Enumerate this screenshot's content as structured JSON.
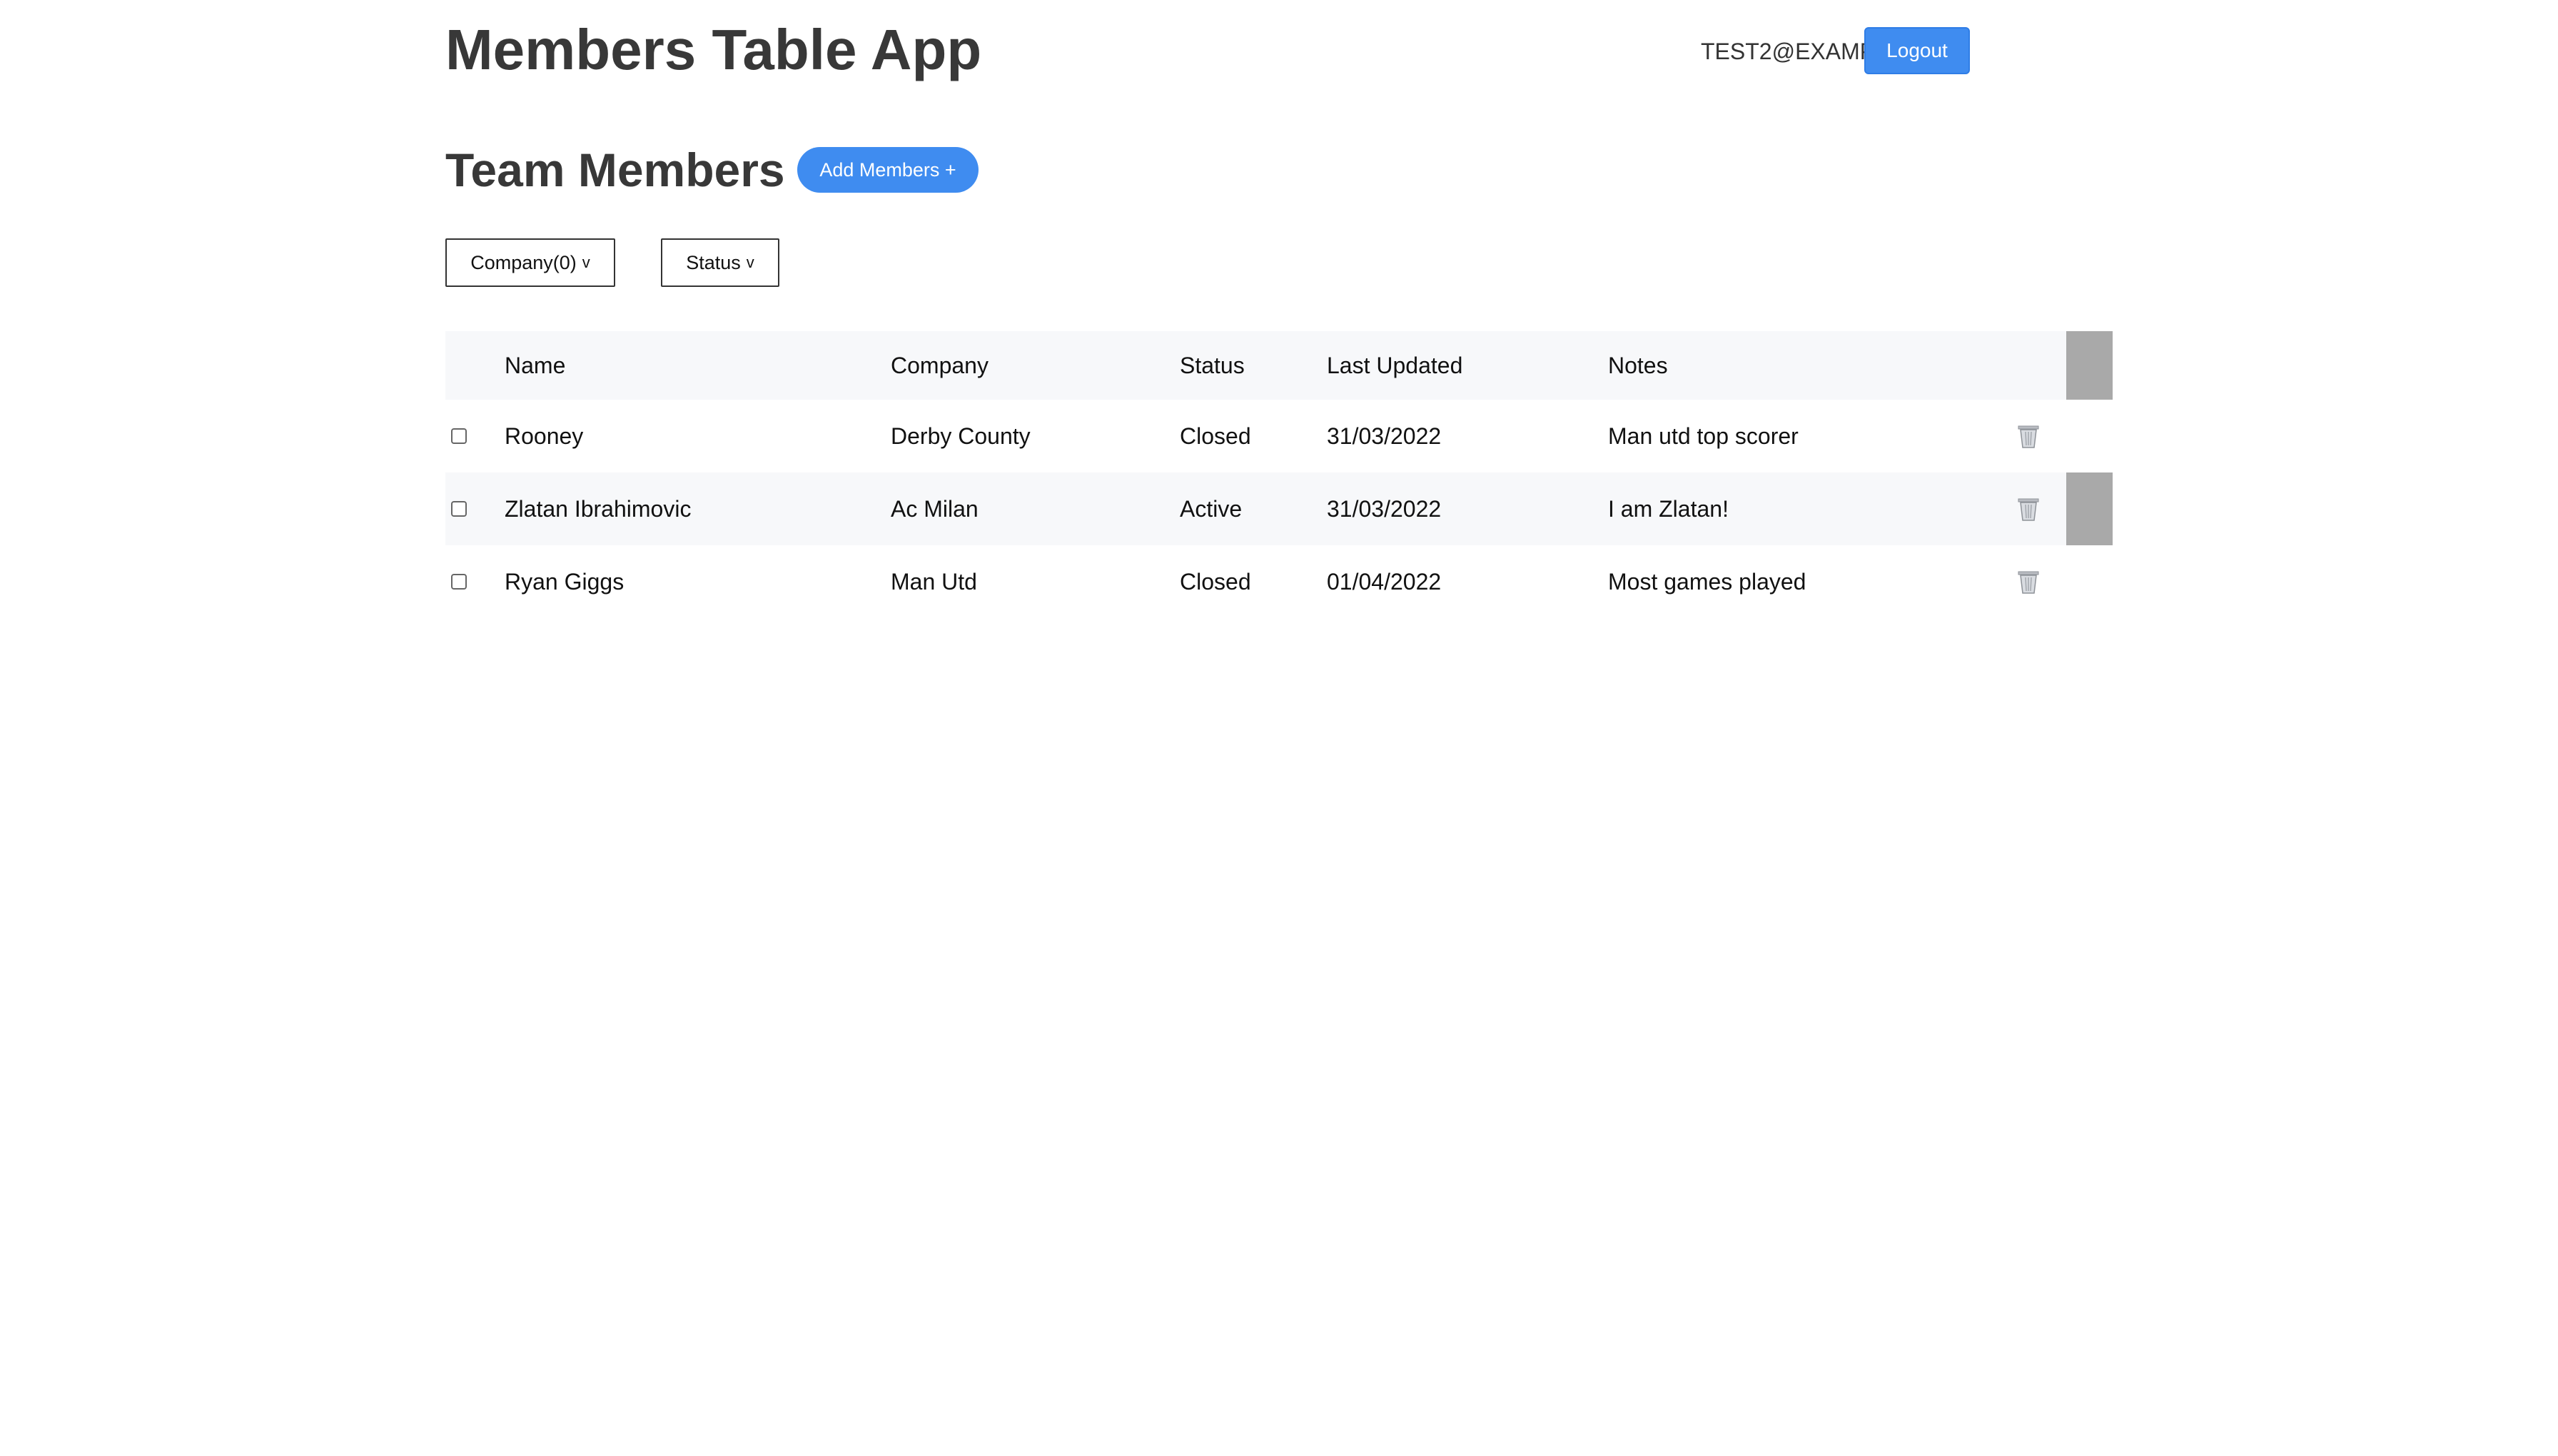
{
  "header": {
    "title": "Members Table App",
    "user_email": "TEST2@EXAMPLE.COM",
    "logout_label": "Logout"
  },
  "section": {
    "title": "Team Members",
    "add_label": "Add Members +"
  },
  "filters": {
    "company_label": "Company(0)",
    "status_label": "Status",
    "chevron": "v"
  },
  "table": {
    "columns": [
      "Name",
      "Company",
      "Status",
      "Last Updated",
      "Notes"
    ],
    "rows": [
      {
        "name": "Rooney",
        "company": "Derby County",
        "status": "Closed",
        "updated": "31/03/2022",
        "notes": "Man utd top scorer"
      },
      {
        "name": "Zlatan Ibrahimovic",
        "company": "Ac Milan",
        "status": "Active",
        "updated": "31/03/2022",
        "notes": "I am Zlatan!"
      },
      {
        "name": "Ryan Giggs",
        "company": "Man Utd",
        "status": "Closed",
        "updated": "01/04/2022",
        "notes": "Most games played"
      }
    ]
  },
  "colors": {
    "accent": "#3f8cf0",
    "row_alt": "#f7f8fa",
    "scroll_block": "#a9a9a9"
  },
  "icons": {
    "delete": "trash-icon",
    "filter_dropdown": "chevron-down-icon"
  }
}
